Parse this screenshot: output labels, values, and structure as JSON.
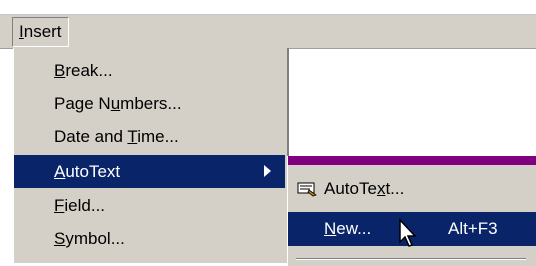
{
  "menubar": {
    "insert_label": "Insert"
  },
  "insert_menu": {
    "items": [
      {
        "label": "Break..."
      },
      {
        "label": "Page Numbers..."
      },
      {
        "label": "Date and Time..."
      },
      {
        "label": "AutoText"
      },
      {
        "label": "Field..."
      },
      {
        "label": "Symbol..."
      }
    ]
  },
  "autotext_submenu": {
    "items": [
      {
        "label": "AutoText...",
        "icon": "autotext-icon"
      },
      {
        "label": "New...",
        "shortcut": "Alt+F3"
      }
    ]
  },
  "colors": {
    "menu_bg": "#d4d0c8",
    "highlight": "#0a246a",
    "submenu_title": "#800080"
  }
}
